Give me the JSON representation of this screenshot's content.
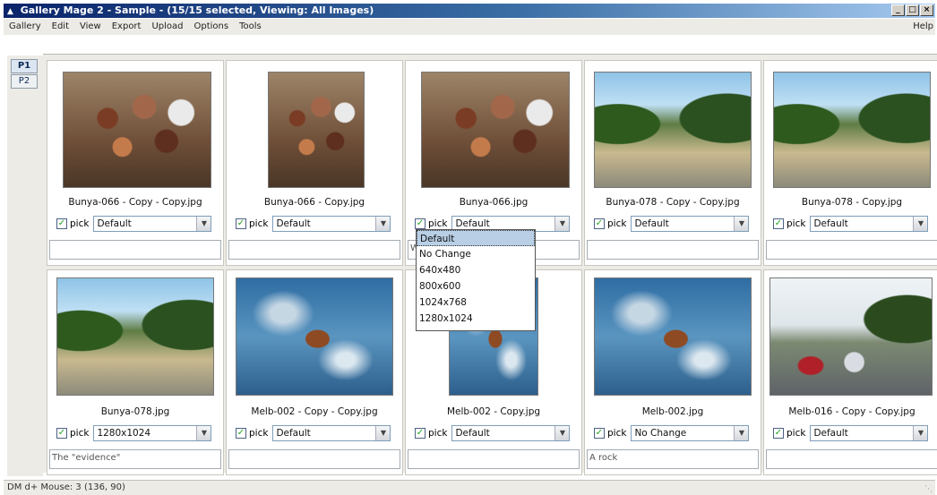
{
  "window": {
    "title": "Gallery Mage 2 - Sample - (15/15 selected, Viewing: All Images)",
    "controls": [
      "_",
      "□",
      "×"
    ]
  },
  "menu": {
    "items": [
      "Gallery",
      "Edit",
      "View",
      "Export",
      "Upload",
      "Options",
      "Tools"
    ],
    "help": "Help"
  },
  "page_tabs": [
    "P1",
    "P2"
  ],
  "cards": [
    {
      "filename": "Bunya-066 - Copy - Copy.jpg",
      "pick_label": "pick",
      "picked": true,
      "size": "Default",
      "caption": "",
      "image": "wood"
    },
    {
      "filename": "Bunya-066 - Copy.jpg",
      "pick_label": "pick",
      "picked": true,
      "size": "Default",
      "caption": "",
      "image": "wood"
    },
    {
      "filename": "Bunya-066.jpg",
      "pick_label": "pick",
      "picked": true,
      "size": "Default",
      "caption": "Woodpile",
      "image": "wood"
    },
    {
      "filename": "Bunya-078 - Copy - Copy.jpg",
      "pick_label": "pick",
      "picked": true,
      "size": "Default",
      "caption": "",
      "image": "road"
    },
    {
      "filename": "Bunya-078 - Copy.jpg",
      "pick_label": "pick",
      "picked": true,
      "size": "Default",
      "caption": "",
      "image": "road"
    },
    {
      "filename": "Bunya-078.jpg",
      "pick_label": "pick",
      "picked": true,
      "size": "1280x1024",
      "caption": "The \"evidence\"",
      "image": "road"
    },
    {
      "filename": "Melb-002 - Copy - Copy.jpg",
      "pick_label": "pick",
      "picked": true,
      "size": "Default",
      "caption": "",
      "image": "sea"
    },
    {
      "filename": "Melb-002 - Copy.jpg",
      "pick_label": "pick",
      "picked": true,
      "size": "Default",
      "caption": "",
      "image": "sea"
    },
    {
      "filename": "Melb-002.jpg",
      "pick_label": "pick",
      "picked": true,
      "size": "No Change",
      "caption": "A rock",
      "image": "sea"
    },
    {
      "filename": "Melb-016 - Copy - Copy.jpg",
      "pick_label": "pick",
      "picked": true,
      "size": "Default",
      "caption": "",
      "image": "cars"
    }
  ],
  "dropdown": {
    "options": [
      "Default",
      "No Change",
      "640x480",
      "800x600",
      "1024x768",
      "1280x1024"
    ],
    "selected": "Default"
  },
  "status": {
    "text": "DM d+ Mouse: 3 (136, 90)"
  }
}
